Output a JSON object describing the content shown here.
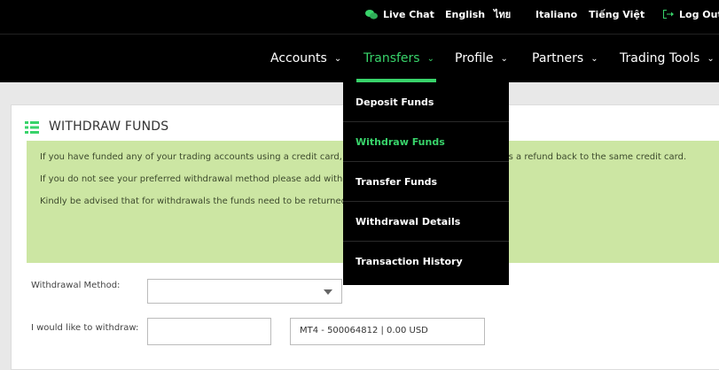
{
  "topbar": {
    "live_chat": "Live Chat",
    "lang_english": "English",
    "lang_thai": "ไทย",
    "lang_italian": "Italiano",
    "lang_vietnamese": "Tiếng Việt",
    "logout": "Log Out"
  },
  "nav": {
    "items": [
      {
        "label": "Accounts",
        "chevron": "⌄"
      },
      {
        "label": "Transfers",
        "chevron": "⌄"
      },
      {
        "label": "Profile",
        "chevron": "⌄"
      },
      {
        "label": "Partners",
        "chevron": "⌄"
      },
      {
        "label": "Trading Tools",
        "chevron": "⌄"
      }
    ]
  },
  "dropdown": {
    "items": [
      "Deposit Funds",
      "Withdraw Funds",
      "Transfer Funds",
      "Withdrawal Details",
      "Transaction History"
    ]
  },
  "panel": {
    "title": "WITHDRAW FUNDS",
    "notice_1": "If you have funded any of your trading accounts using a credit card, your withdrawals will be processed as a refund back to the same credit card.",
    "notice_2": "If you do not see your preferred withdrawal method please add withdrawal details.",
    "notice_3": "Kindly be advised that for withdrawals the funds need to be returned to the original source."
  },
  "form": {
    "method_label": "Withdrawal Method:",
    "method_value": "",
    "amount_label": "I would like to withdraw:",
    "amount_value": "",
    "account_value": "MT4 - 500064812 | 0.00 USD"
  },
  "colors": {
    "accent": "#38d36a",
    "notice_bg": "#cce6a3"
  }
}
